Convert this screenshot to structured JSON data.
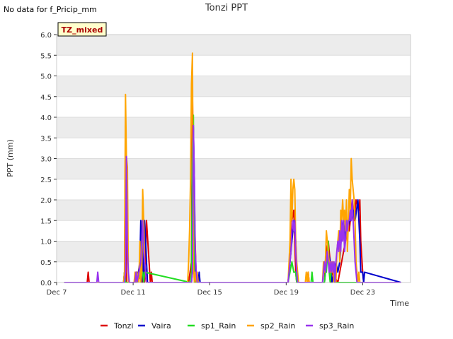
{
  "notice": "No data for f_Pricip_mm",
  "chart_data": {
    "type": "line",
    "title": "Tonzi PPT",
    "xlabel": "Time",
    "ylabel": "PPT (mm)",
    "badge": "TZ_mixed",
    "xlim": [
      7,
      25.5
    ],
    "ylim": [
      0,
      6
    ],
    "x_ticks": [
      7,
      11,
      15,
      19,
      23
    ],
    "x_tick_labels": [
      "Dec 7",
      "Dec 11",
      "Dec 15",
      "Dec 19",
      "Dec 23"
    ],
    "y_ticks": [
      "0.0",
      "0.5",
      "1.0",
      "1.5",
      "2.0",
      "2.5",
      "3.0",
      "3.5",
      "4.0",
      "4.5",
      "5.0",
      "5.5",
      "6.0"
    ],
    "grid": "horizontal bands",
    "legend_position": "bottom",
    "series": [
      {
        "name": "Tonzi",
        "color": "#dd0000",
        "x": [
          7.4,
          8.6,
          8.65,
          8.7,
          10.55,
          10.6,
          10.65,
          11.1,
          11.2,
          11.5,
          11.55,
          11.6,
          11.7,
          11.9,
          11.95,
          12.0,
          13.9,
          14.05,
          14.1,
          14.15,
          14.3,
          19.1,
          19.2,
          19.25,
          19.3,
          19.4,
          19.5,
          19.55,
          19.6,
          20.1,
          20.15,
          20.2,
          21.0,
          21.05,
          21.1,
          21.2,
          21.3,
          21.35,
          21.4,
          21.7,
          22.1,
          22.2,
          22.3,
          22.45,
          22.55,
          22.65,
          22.8,
          22.85,
          22.9,
          23.0,
          23.05,
          25.0
        ],
        "y": [
          0,
          0,
          0.25,
          0,
          0,
          3.8,
          0,
          0,
          0.25,
          0,
          1.5,
          0,
          1.5,
          0,
          0.25,
          0,
          0,
          0.5,
          4.55,
          2.55,
          0,
          0,
          0.5,
          1.75,
          1.5,
          1.75,
          0.25,
          0,
          0,
          0,
          0.25,
          0,
          0,
          0.5,
          0.75,
          1.0,
          0.5,
          0,
          0.25,
          0,
          1.0,
          1.5,
          1.25,
          2.0,
          1.5,
          2.0,
          1.75,
          2.0,
          1.0,
          0.25,
          0,
          0
        ]
      },
      {
        "name": "Vaira",
        "color": "#0000cc",
        "x": [
          7.4,
          10.5,
          10.55,
          10.6,
          11.1,
          11.15,
          11.2,
          11.35,
          11.4,
          11.45,
          11.5,
          11.55,
          11.6,
          11.65,
          11.7,
          11.75,
          14.05,
          14.1,
          14.15,
          14.2,
          14.25,
          14.4,
          14.45,
          14.5,
          19.1,
          19.15,
          19.2,
          19.3,
          19.4,
          19.5,
          19.55,
          19.6,
          21.0,
          21.05,
          21.1,
          21.2,
          21.3,
          21.35,
          21.4,
          21.6,
          21.7,
          21.8,
          21.9,
          22.0,
          22.05,
          22.1,
          22.2,
          22.3,
          22.4,
          22.5,
          22.6,
          22.75,
          22.85,
          22.9,
          23.0,
          23.05,
          23.1,
          25.0
        ],
        "y": [
          0,
          0,
          0.25,
          0,
          0,
          0.25,
          0,
          0.5,
          1.5,
          0,
          1.5,
          0,
          1.5,
          1.0,
          0.5,
          0,
          0,
          0.25,
          3.75,
          2.5,
          0,
          0,
          0.25,
          0,
          0,
          0.25,
          0.5,
          1.0,
          1.5,
          1.0,
          0.25,
          0,
          0,
          0.25,
          0.5,
          0.75,
          0.5,
          0.25,
          0,
          0.5,
          0.25,
          0.5,
          1.25,
          1.5,
          1.0,
          1.5,
          1.25,
          1.5,
          1.5,
          1.75,
          1.5,
          2.0,
          1.0,
          0.25,
          0.25,
          0,
          0.25,
          0
        ]
      },
      {
        "name": "sp1_Rain",
        "color": "#22dd22",
        "x": [
          7.4,
          10.5,
          10.55,
          10.6,
          11.1,
          11.15,
          11.2,
          11.45,
          11.5,
          11.55,
          11.6,
          14.0,
          14.05,
          14.1,
          14.15,
          14.2,
          19.1,
          19.2,
          19.3,
          19.4,
          19.5,
          19.55,
          20.3,
          20.35,
          20.4,
          21.0,
          21.05,
          21.1,
          21.2,
          21.25,
          21.3,
          21.35,
          21.4,
          21.45,
          21.5,
          25.0
        ],
        "y": [
          0,
          0,
          0.25,
          0,
          0,
          0.25,
          0,
          0.25,
          0.25,
          0,
          0.25,
          0,
          0.25,
          3.3,
          4.05,
          0,
          0,
          0.25,
          0.5,
          0.25,
          0.25,
          0,
          0,
          0.25,
          0,
          0,
          0.25,
          0.25,
          1.0,
          0.25,
          0,
          0.25,
          0.25,
          0.5,
          0,
          0
        ]
      },
      {
        "name": "sp2_Rain",
        "color": "#ffa500",
        "x": [
          7.4,
          10.5,
          10.55,
          10.6,
          10.65,
          10.7,
          10.75,
          11.05,
          11.1,
          11.15,
          11.2,
          11.3,
          11.35,
          11.4,
          11.45,
          11.5,
          11.55,
          11.6,
          11.65,
          11.7,
          11.75,
          13.85,
          13.9,
          13.95,
          14.0,
          14.05,
          14.1,
          14.15,
          14.2,
          14.25,
          14.3,
          14.35,
          14.4,
          19.1,
          19.15,
          19.2,
          19.25,
          19.3,
          19.35,
          19.4,
          19.45,
          19.5,
          19.55,
          19.6,
          19.65,
          19.7,
          20.0,
          20.05,
          20.1,
          20.15,
          20.2,
          20.3,
          20.9,
          20.95,
          21.0,
          21.05,
          21.1,
          21.15,
          21.2,
          21.25,
          21.3,
          21.35,
          21.4,
          21.45,
          21.5,
          21.55,
          21.6,
          21.65,
          21.7,
          21.75,
          21.8,
          21.85,
          21.9,
          21.95,
          22.0,
          22.05,
          22.1,
          22.15,
          22.2,
          22.25,
          22.3,
          22.35,
          22.4,
          22.45,
          22.5,
          22.55,
          22.6,
          22.65,
          22.7,
          22.75,
          22.8,
          22.85,
          22.9,
          22.95,
          23.0,
          25.0
        ],
        "y": [
          0,
          0,
          0.25,
          4.55,
          3.05,
          2.8,
          0,
          0,
          0.25,
          0,
          0.25,
          0,
          1.0,
          0,
          0.25,
          2.25,
          1.5,
          0.5,
          0.25,
          0,
          0,
          0,
          0.5,
          1.25,
          2.5,
          4.8,
          5.55,
          0.5,
          0,
          0.25,
          0,
          0.25,
          0,
          0,
          0.5,
          1.0,
          2.5,
          1.5,
          2.25,
          2.5,
          2.25,
          1.0,
          0.5,
          0.25,
          0,
          0,
          0,
          0.25,
          0,
          0.25,
          0,
          0,
          0,
          0.5,
          0.25,
          0.5,
          1.25,
          1.0,
          0.75,
          0.5,
          0.25,
          0.5,
          0.25,
          0.5,
          0,
          0.25,
          0,
          0.75,
          1.0,
          1.25,
          0.5,
          1.75,
          1.5,
          2.0,
          1.5,
          1.75,
          1.25,
          2.0,
          0.75,
          1.5,
          2.25,
          1.75,
          3.0,
          2.5,
          2.25,
          2.0,
          1.5,
          0.5,
          0.25,
          0,
          0.25,
          0,
          0,
          0,
          0,
          0
        ]
      },
      {
        "name": "sp3_Rain",
        "color": "#9933ee",
        "x": [
          7.4,
          9.1,
          9.15,
          9.2,
          10.55,
          10.6,
          10.65,
          10.7,
          10.75,
          10.8,
          11.1,
          11.15,
          11.2,
          11.4,
          11.45,
          11.5,
          11.55,
          11.6,
          11.65,
          11.7,
          14.05,
          14.1,
          14.15,
          14.2,
          14.25,
          14.3,
          14.35,
          19.1,
          19.15,
          19.2,
          19.25,
          19.3,
          19.35,
          19.4,
          19.45,
          19.5,
          19.55,
          19.6,
          20.9,
          20.95,
          21.0,
          21.05,
          21.1,
          21.15,
          21.2,
          21.25,
          21.3,
          21.35,
          21.4,
          21.45,
          21.5,
          21.55,
          21.6,
          21.65,
          21.7,
          21.75,
          21.8,
          21.85,
          21.9,
          21.95,
          22.0,
          22.05,
          22.1,
          22.15,
          22.2,
          22.25,
          22.3,
          22.35,
          22.4,
          22.45,
          22.5,
          22.55,
          22.6,
          22.65,
          22.7,
          22.75,
          22.8,
          22.85,
          22.9,
          22.95,
          23.0,
          25.0
        ],
        "y": [
          0,
          0,
          0.25,
          0,
          0,
          0.25,
          3.05,
          0.75,
          0.25,
          0,
          0,
          0.25,
          0,
          0.5,
          1.0,
          1.5,
          0.75,
          0.5,
          0.25,
          0,
          0,
          0.25,
          3.8,
          2.5,
          0.75,
          0.25,
          0,
          0,
          0.25,
          0.5,
          0.75,
          1.25,
          1.5,
          1.25,
          1.5,
          0.75,
          0.25,
          0,
          0,
          0.25,
          0.5,
          0.25,
          0.5,
          0.75,
          0.5,
          0.25,
          0.5,
          0.25,
          0.5,
          0.25,
          0.5,
          0,
          0.5,
          0.75,
          1.0,
          0.75,
          1.25,
          0.75,
          1.5,
          1.0,
          1.5,
          0.75,
          1.0,
          1.5,
          1.25,
          1.5,
          1.5,
          1.75,
          1.5,
          2.0,
          1.5,
          1.0,
          0.5,
          0.25,
          0,
          0,
          0,
          0,
          0,
          0,
          0,
          0
        ]
      }
    ]
  }
}
